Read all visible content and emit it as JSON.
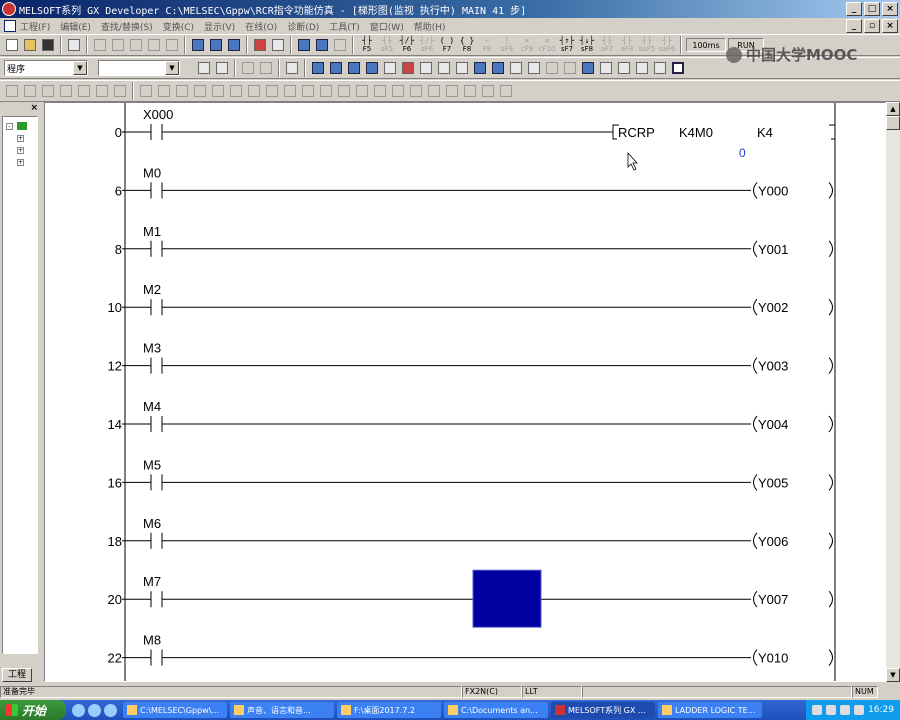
{
  "window": {
    "title": "MELSOFT系列 GX Developer C:\\MELSEC\\Gppw\\RCR指令功能仿真 - [梯形图(监视 执行中)    MAIN    41 步]"
  },
  "menu": [
    "工程(F)",
    "编辑(E)",
    "查找/替换(S)",
    "变换(C)",
    "显示(V)",
    "在线(O)",
    "诊断(D)",
    "工具(T)",
    "窗口(W)",
    "帮助(H)"
  ],
  "toolbar": {
    "program_combo": "程序",
    "second_combo": "",
    "scan_time": "100ms",
    "run_state": "RUN",
    "fkeys": [
      "F5",
      "sF5",
      "F6",
      "sF6",
      "F7",
      "F8",
      "F9",
      "sF9",
      "cF9",
      "cF10",
      "sF7",
      "sF8",
      "aF7",
      "aF8",
      "saF5",
      "saF6"
    ]
  },
  "watermark": "中国大学MOOC",
  "tree": {
    "tab_label": "工程"
  },
  "ladder": {
    "rungs": [
      {
        "step": "0",
        "contact": "X000",
        "instruction": "RCRP",
        "op1": "K4M0",
        "op2": "K4",
        "monitor": "0"
      },
      {
        "step": "6",
        "contact": "M0",
        "coil": "Y000"
      },
      {
        "step": "8",
        "contact": "M1",
        "coil": "Y001"
      },
      {
        "step": "10",
        "contact": "M2",
        "coil": "Y002"
      },
      {
        "step": "12",
        "contact": "M3",
        "coil": "Y003"
      },
      {
        "step": "14",
        "contact": "M4",
        "coil": "Y004"
      },
      {
        "step": "16",
        "contact": "M5",
        "coil": "Y005"
      },
      {
        "step": "18",
        "contact": "M6",
        "coil": "Y006"
      },
      {
        "step": "20",
        "contact": "M7",
        "coil": "Y007"
      },
      {
        "step": "22",
        "contact": "M8",
        "coil": "Y010"
      }
    ]
  },
  "statusbar": {
    "message": "准备完毕",
    "plc_type": "FX2N(C)",
    "mode": "LLT",
    "num": "NUM"
  },
  "taskbar": {
    "start": "开始",
    "items": [
      "C:\\MELSEC\\Gppw\\...",
      "声音、语言和音...",
      "F:\\桌面2017.7.2",
      "C:\\Documents an...",
      "MELSOFT系列 GX ...",
      "LADDER LOGIC TE..."
    ],
    "clock": "16:29"
  },
  "colors": {
    "cursor_block": "#0000a0",
    "monitor_value": "#2a3cc8",
    "titlebar": "#0a246a"
  }
}
